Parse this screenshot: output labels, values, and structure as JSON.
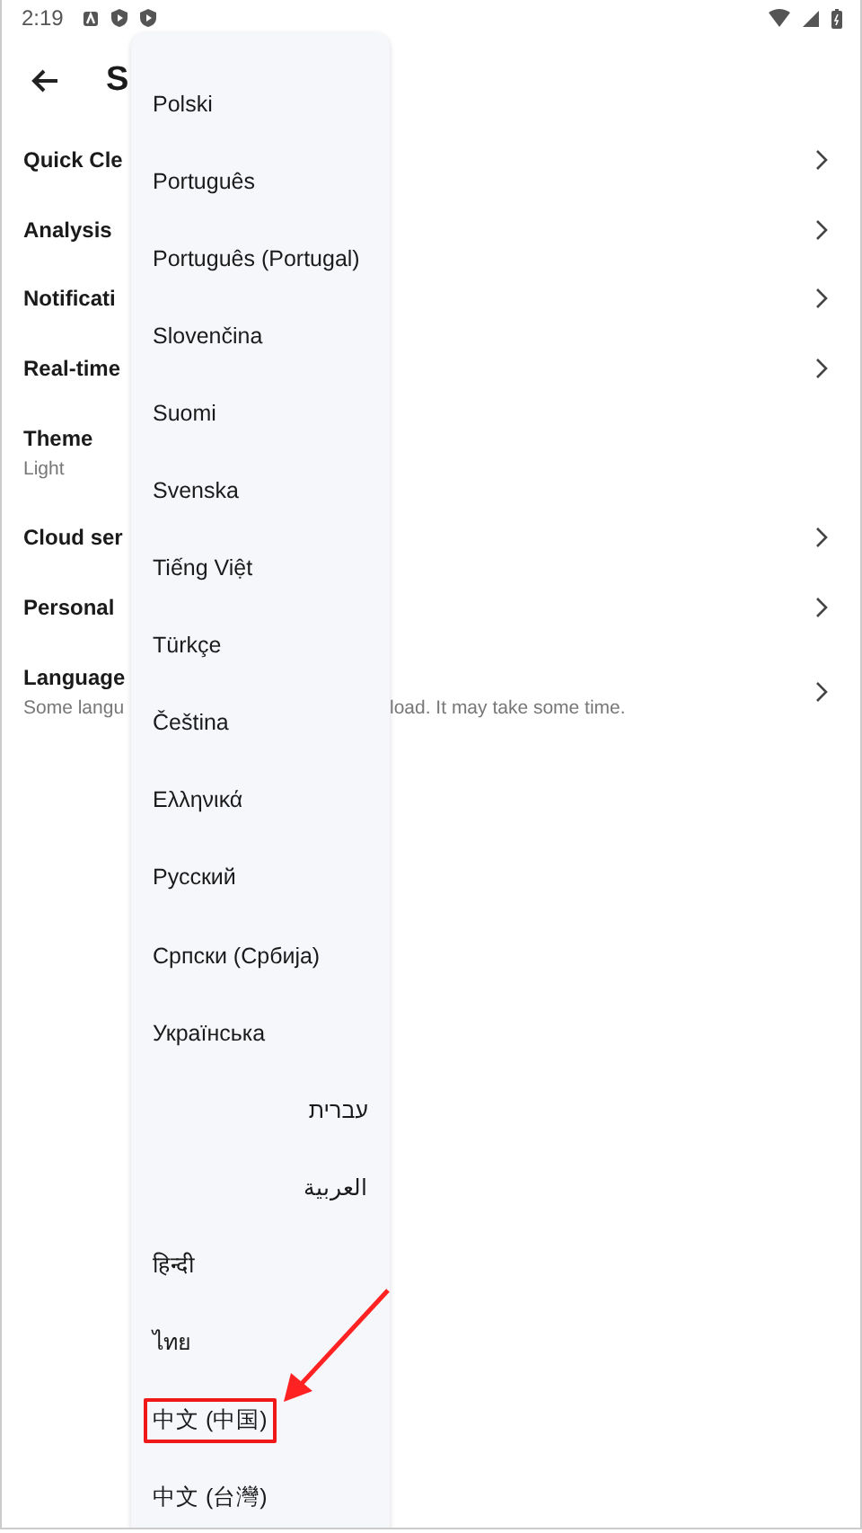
{
  "status_bar": {
    "time": "2:19"
  },
  "toolbar": {
    "title": "S"
  },
  "settings": [
    {
      "title": "Quick Cle",
      "chevron": true
    },
    {
      "title": "Analysis",
      "chevron": true
    },
    {
      "title": "Notificati",
      "chevron": true
    },
    {
      "title": "Real-time",
      "chevron": true
    },
    {
      "title": "Theme",
      "subtitle": "Light",
      "chevron": false
    },
    {
      "title": "Cloud ser",
      "chevron": true
    },
    {
      "title": "Personal",
      "chevron": true
    },
    {
      "title": "Language",
      "description_parts": [
        "Some langu",
        "load. It may take some time."
      ],
      "chevron": true
    }
  ],
  "language_menu": {
    "items": [
      {
        "label": "Polski",
        "highlighted": false
      },
      {
        "label": "Português",
        "highlighted": false
      },
      {
        "label": "Português (Portugal)",
        "highlighted": false
      },
      {
        "label": "Slovenčina",
        "highlighted": false
      },
      {
        "label": "Suomi",
        "highlighted": false
      },
      {
        "label": "Svenska",
        "highlighted": false
      },
      {
        "label": "Tiếng Việt",
        "highlighted": false
      },
      {
        "label": "Türkçe",
        "highlighted": false
      },
      {
        "label": "Čeština",
        "highlighted": false
      },
      {
        "label": "Ελληνικά",
        "highlighted": false
      },
      {
        "label": "Русский",
        "highlighted": false
      },
      {
        "label": "Српски (Србија)",
        "highlighted": false
      },
      {
        "label": "Українська",
        "highlighted": false
      },
      {
        "label": "עברית",
        "rtl": true,
        "highlighted": false
      },
      {
        "label": "العربية",
        "rtl": true,
        "highlighted": false
      },
      {
        "label": "हिन्दी",
        "highlighted": false
      },
      {
        "label": "ไทย",
        "highlighted": false
      },
      {
        "label": "中文 (中国)",
        "highlighted": true
      },
      {
        "label": "中文 (台灣)",
        "highlighted": false
      }
    ]
  }
}
